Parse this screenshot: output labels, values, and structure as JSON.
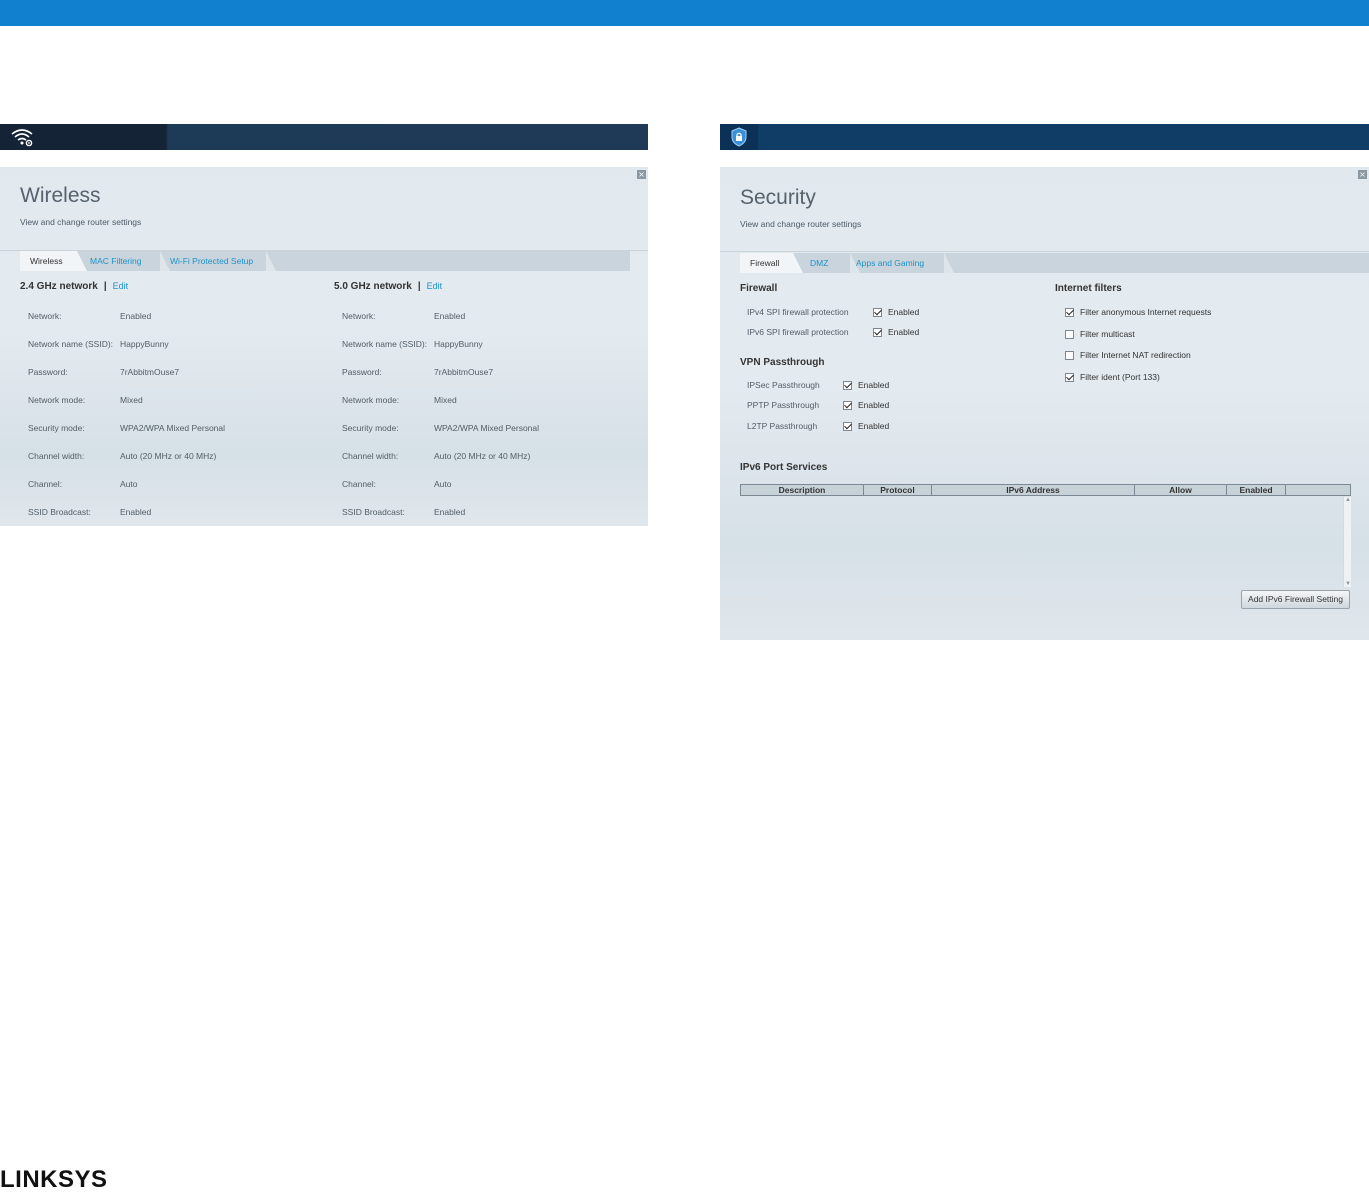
{
  "brand": {
    "logo_text": "LINKSYS"
  },
  "wireless": {
    "title": "Wireless",
    "subtitle": "View and change router settings",
    "tabs": [
      "Wireless",
      "MAC Filtering",
      "Wi-Fi Protected Setup"
    ],
    "networks": [
      {
        "heading": "2.4 GHz network",
        "edit": "Edit",
        "rows": [
          {
            "label": "Network:",
            "value": "Enabled"
          },
          {
            "label": "Network name (SSID):",
            "value": "HappyBunny"
          },
          {
            "label": "Password:",
            "value": "7rAbbitmOuse7"
          },
          {
            "label": "Network mode:",
            "value": "Mixed"
          },
          {
            "label": "Security mode:",
            "value": "WPA2/WPA Mixed Personal"
          },
          {
            "label": "Channel width:",
            "value": "Auto (20 MHz or 40 MHz)"
          },
          {
            "label": "Channel:",
            "value": "Auto"
          },
          {
            "label": "SSID Broadcast:",
            "value": "Enabled"
          }
        ]
      },
      {
        "heading": "5.0 GHz network",
        "edit": "Edit",
        "rows": [
          {
            "label": "Network:",
            "value": "Enabled"
          },
          {
            "label": "Network name (SSID):",
            "value": "HappyBunny"
          },
          {
            "label": "Password:",
            "value": "7rAbbitmOuse7"
          },
          {
            "label": "Network mode:",
            "value": "Mixed"
          },
          {
            "label": "Security mode:",
            "value": "WPA2/WPA Mixed Personal"
          },
          {
            "label": "Channel width:",
            "value": "Auto (20 MHz or 40 MHz)"
          },
          {
            "label": "Channel:",
            "value": "Auto"
          },
          {
            "label": "SSID Broadcast:",
            "value": "Enabled"
          }
        ]
      }
    ]
  },
  "security": {
    "title": "Security",
    "subtitle": "View and change router settings",
    "tabs": [
      "Firewall",
      "DMZ",
      "Apps and Gaming"
    ],
    "firewall": {
      "heading": "Firewall",
      "items": [
        {
          "label": "IPv4 SPI firewall protection",
          "checked": true,
          "text": "Enabled"
        },
        {
          "label": "IPv6 SPI firewall protection",
          "checked": true,
          "text": "Enabled"
        }
      ]
    },
    "vpn": {
      "heading": "VPN Passthrough",
      "items": [
        {
          "label": "IPSec Passthrough",
          "checked": true,
          "text": "Enabled"
        },
        {
          "label": "PPTP Passthrough",
          "checked": true,
          "text": "Enabled"
        },
        {
          "label": "L2TP Passthrough",
          "checked": true,
          "text": "Enabled"
        }
      ]
    },
    "internet_filters": {
      "heading": "Internet filters",
      "items": [
        {
          "label": "Filter anonymous Internet requests",
          "checked": true
        },
        {
          "label": "Filter multicast",
          "checked": false
        },
        {
          "label": "Filter Internet NAT redirection",
          "checked": false
        },
        {
          "label": "Filter ident (Port 133)",
          "checked": true
        }
      ]
    },
    "ipv6": {
      "heading": "IPv6 Port Services",
      "columns": [
        "Description",
        "Protocol",
        "IPv6 Address",
        "Allow",
        "Enabled",
        ""
      ],
      "add_button": "Add IPv6 Firewall Setting"
    }
  }
}
